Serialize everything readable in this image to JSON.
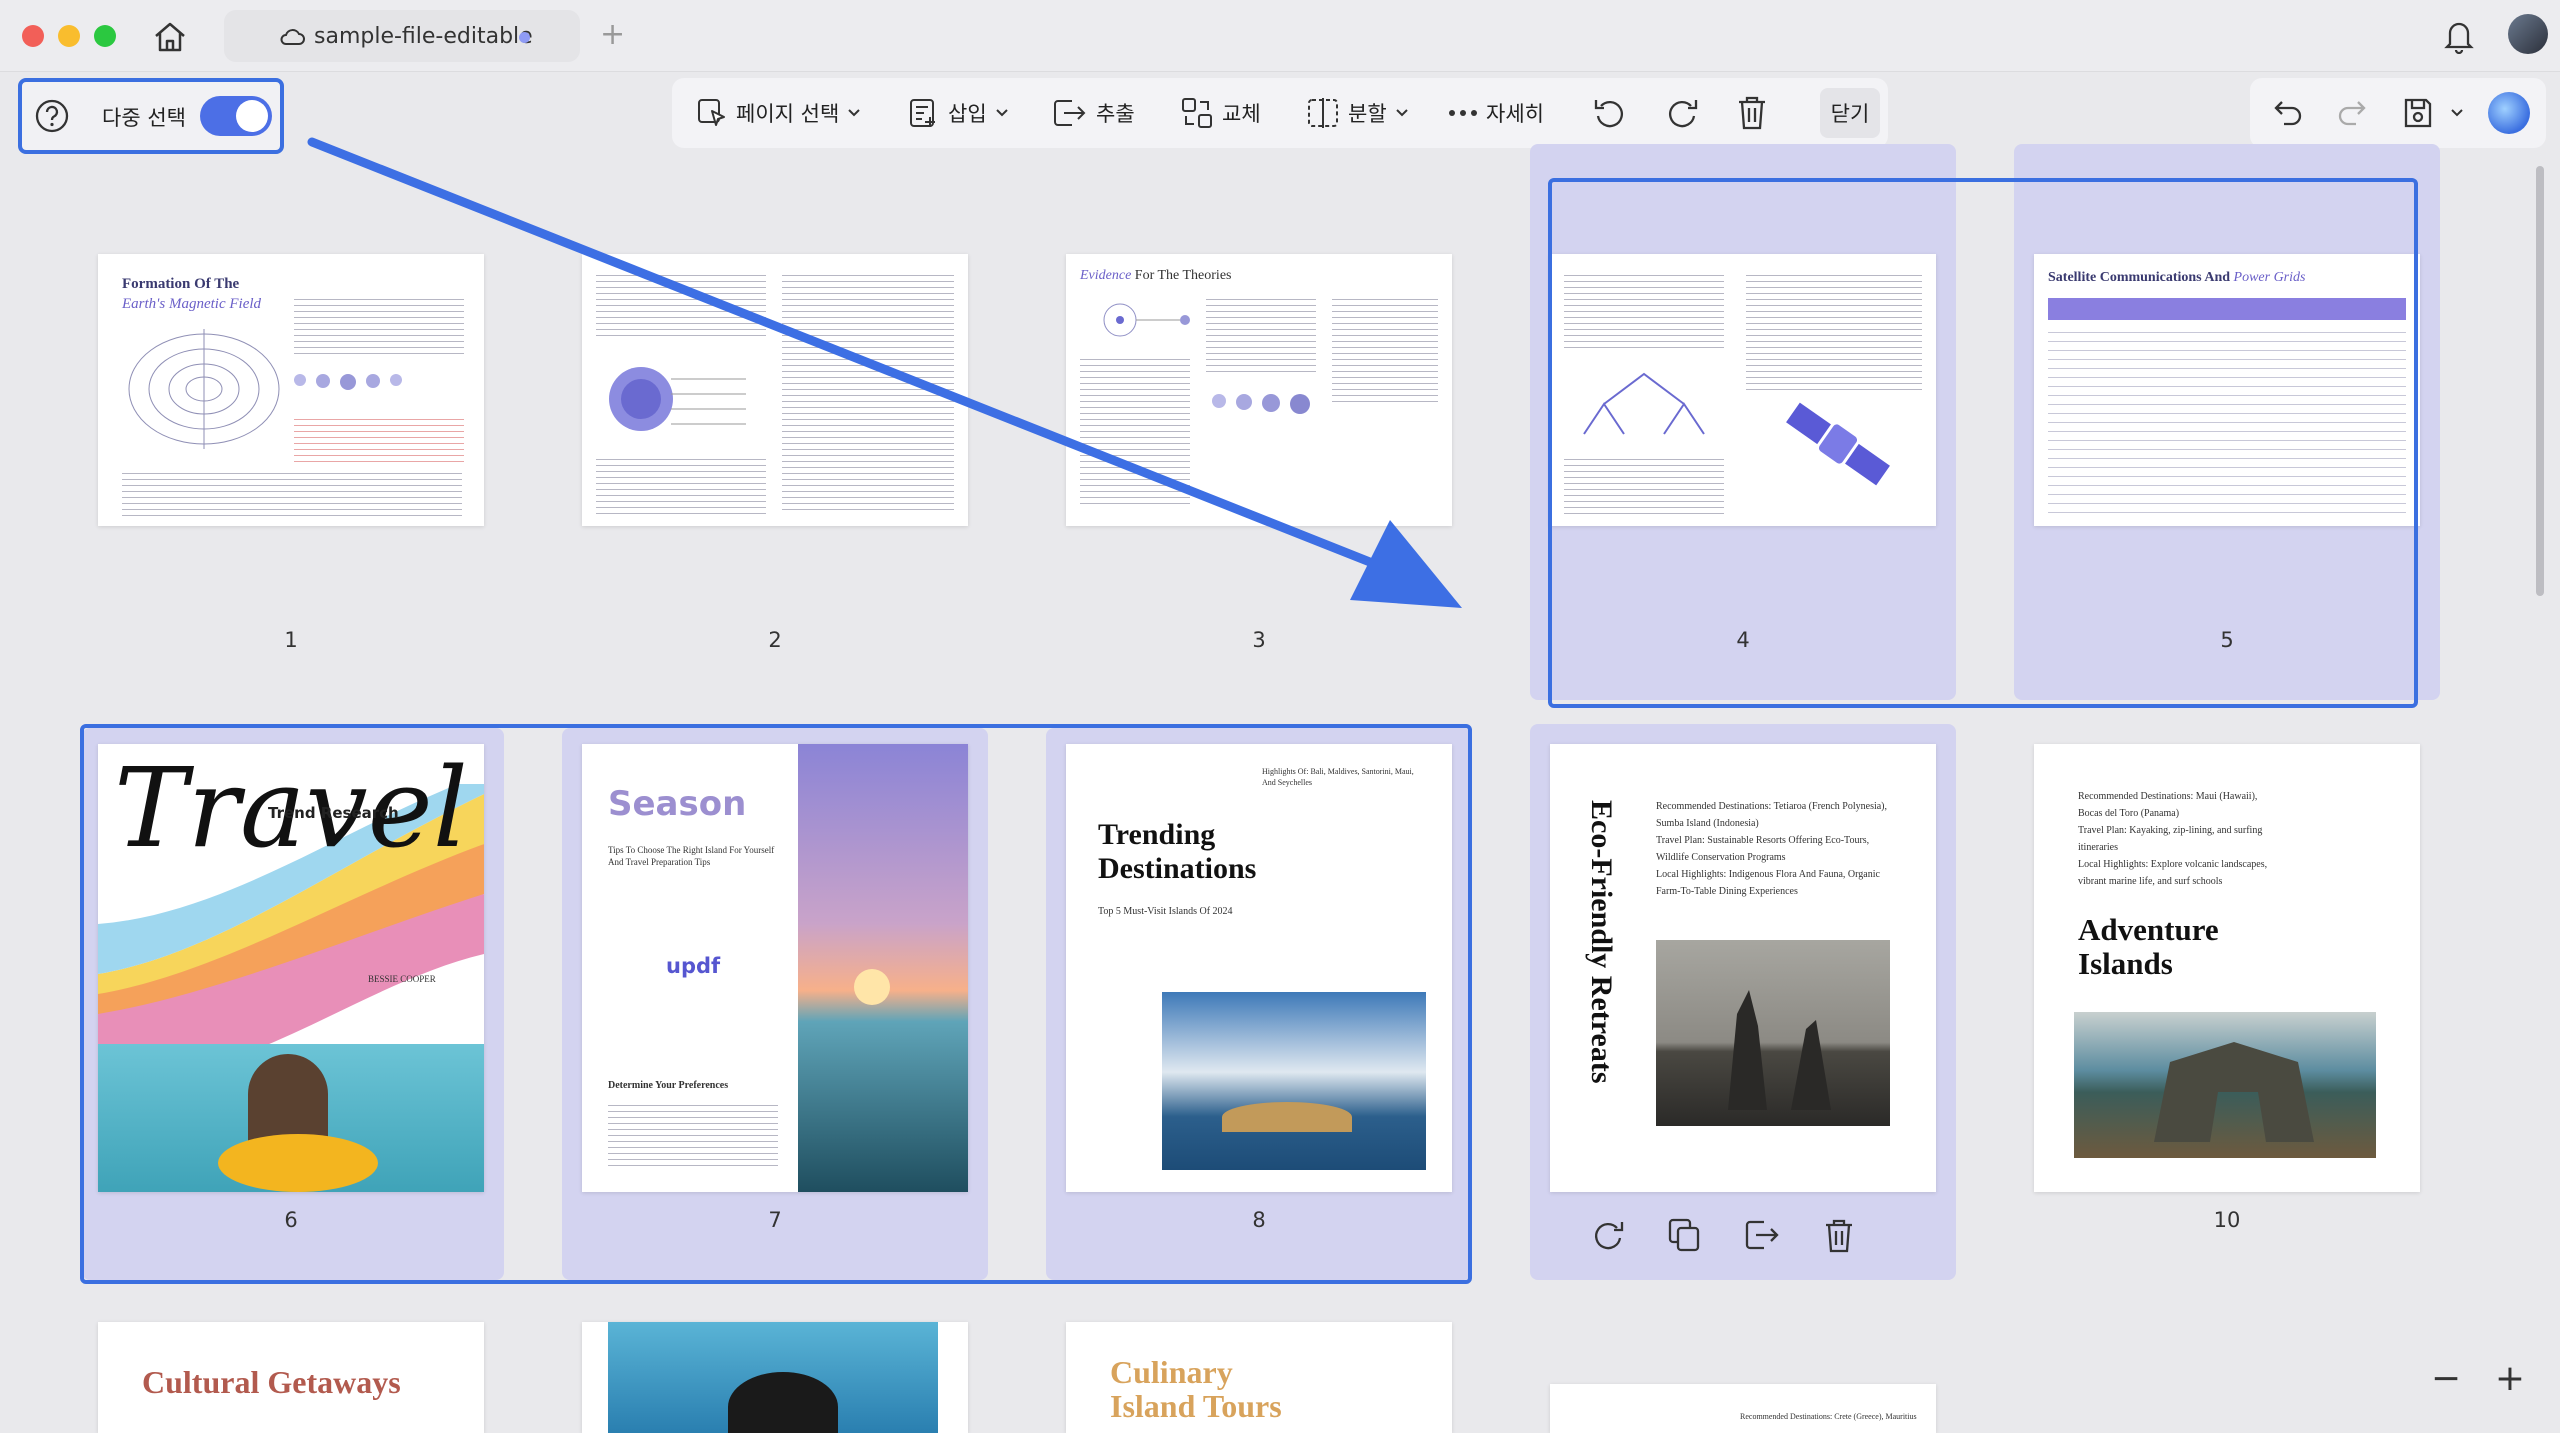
{
  "window": {
    "tab_title": "sample-file-editable"
  },
  "toolbar_left": {
    "multi_select_label": "다중 선택"
  },
  "toolbar": {
    "page_select": "페이지 선택",
    "insert": "삽입",
    "extract": "추출",
    "replace": "교체",
    "split": "분할",
    "more": "자세히",
    "close": "닫기"
  },
  "pages": {
    "p1": {
      "num": "1",
      "title": "Formation Of The",
      "subtitle": "Earth's Magnetic Field"
    },
    "p2": {
      "num": "2"
    },
    "p3": {
      "num": "3",
      "title1": "Evidence",
      "title2": "For The Theories"
    },
    "p4": {
      "num": "4"
    },
    "p5": {
      "num": "5",
      "title1": "Satellite Communications And",
      "title2": "Power Grids"
    },
    "p6": {
      "num": "6",
      "script": "Travel",
      "label": "Trend Research",
      "author": "BESSIE COOPER"
    },
    "p7": {
      "num": "7",
      "title": "Season",
      "brand": "updf",
      "body1": "Tips To Choose The Right Island For Yourself And Travel Preparation Tips",
      "heading": "Determine Your Preferences"
    },
    "p8": {
      "num": "8",
      "top": "Highlights Of: Bali, Maldives, Santorini, Maui, And Seychelles",
      "title1": "Trending",
      "title2": "Destinations",
      "sub": "Top 5 Must-Visit Islands Of 2024"
    },
    "p9": {
      "vertical": "Eco-Friendly Retreats",
      "l1": "Recommended Destinations: Tetiaroa (French Polynesia),",
      "l2": "Sumba Island (Indonesia)",
      "l3": "Travel Plan: Sustainable Resorts Offering Eco-Tours,",
      "l4": "Wildlife Conservation Programs",
      "l5": "Local Highlights: Indigenous Flora And Fauna, Organic",
      "l6": "Farm-To-Table Dining Experiences"
    },
    "p10": {
      "num": "10",
      "l1": "Recommended Destinations: Maui (Hawaii),",
      "l2": "Bocas del Toro (Panama)",
      "l3": "Travel Plan: Kayaking, zip-lining, and surfing",
      "l4": "itineraries",
      "l5": "Local Highlights: Explore volcanic landscapes,",
      "l6": "vibrant marine life, and surf schools",
      "title1": "Adventure",
      "title2": "Islands"
    },
    "p11": {
      "title": "Cultural Getaways"
    },
    "p13": {
      "title1": "Culinary",
      "title2": "Island Tours"
    },
    "p14": {
      "text": "Recommended Destinations: Crete (Greece), Mauritius"
    }
  },
  "colors": {
    "accent": "#3b6fe0",
    "selection": "#d3d3f0"
  }
}
